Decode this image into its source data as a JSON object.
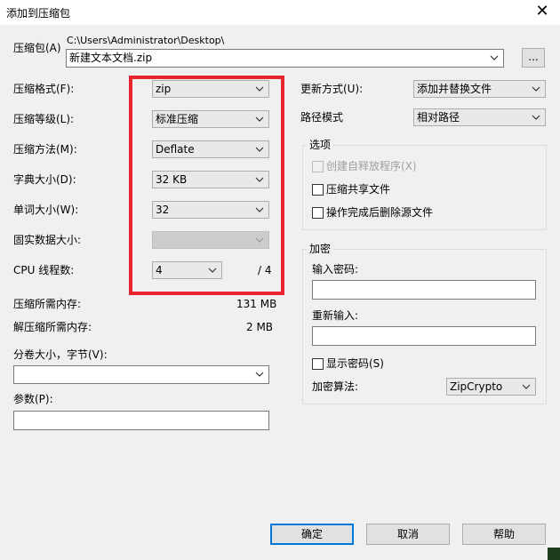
{
  "window": {
    "title": "添加到压缩包"
  },
  "archive": {
    "label": "压缩包(A)",
    "path": "C:\\Users\\Administrator\\Desktop\\",
    "filename": "新建文本文档.zip",
    "browse_label": "..."
  },
  "left": {
    "format": {
      "label": "压缩格式(F):",
      "value": "zip"
    },
    "level": {
      "label": "压缩等级(L):",
      "value": "标准压缩"
    },
    "method": {
      "label": "压缩方法(M):",
      "value": "Deflate"
    },
    "dict": {
      "label": "字典大小(D):",
      "value": "32 KB"
    },
    "word": {
      "label": "单词大小(W):",
      "value": "32"
    },
    "solid": {
      "label": "固实数据大小:",
      "value": ""
    },
    "cpu": {
      "label": "CPU 线程数:",
      "value": "4",
      "total": "/ 4"
    },
    "mem_compress": {
      "label": "压缩所需内存:",
      "value": "131 MB"
    },
    "mem_decompress": {
      "label": "解压缩所需内存:",
      "value": "2 MB"
    },
    "split": {
      "label": "分卷大小，字节(V):",
      "value": ""
    },
    "params": {
      "label": "参数(P):",
      "value": ""
    }
  },
  "right": {
    "update": {
      "label": "更新方式(U):",
      "value": "添加并替换文件"
    },
    "path_mode": {
      "label": "路径模式",
      "value": "相对路径"
    },
    "options": {
      "title": "选项",
      "sfx": "创建自释放程序(X)",
      "shared": "压缩共享文件",
      "delete": "操作完成后删除源文件"
    },
    "encryption": {
      "title": "加密",
      "password_label": "输入密码:",
      "reenter_label": "重新输入:",
      "show_password": "显示密码(S)",
      "method_label": "加密算法:",
      "method_value": "ZipCrypto"
    }
  },
  "buttons": {
    "ok": "确定",
    "cancel": "取消",
    "help": "帮助"
  }
}
